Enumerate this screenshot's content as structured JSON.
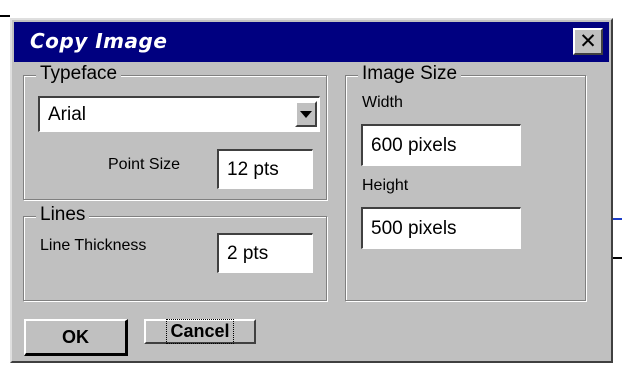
{
  "dialog": {
    "title": "Copy Image",
    "close_glyph": "✕",
    "icons": {
      "close": "close-icon",
      "dropdown": "chevron-down-icon"
    }
  },
  "typeface": {
    "group_label": "Typeface",
    "selected_font": "Arial",
    "point_size_label": "Point Size",
    "point_size_value": "12  pts"
  },
  "lines": {
    "group_label": "Lines",
    "thickness_label": "Line Thickness",
    "thickness_value": "2  pts"
  },
  "image_size": {
    "group_label": "Image Size",
    "width_label": "Width",
    "width_value": "600 pixels",
    "height_label": "Height",
    "height_value": "500 pixels"
  },
  "buttons": {
    "ok_label": "OK",
    "cancel_label": "Cancel"
  },
  "colors": {
    "title_bar": "#000080",
    "dialog_face": "#c0c0c0",
    "field_bg": "#ffffff"
  }
}
